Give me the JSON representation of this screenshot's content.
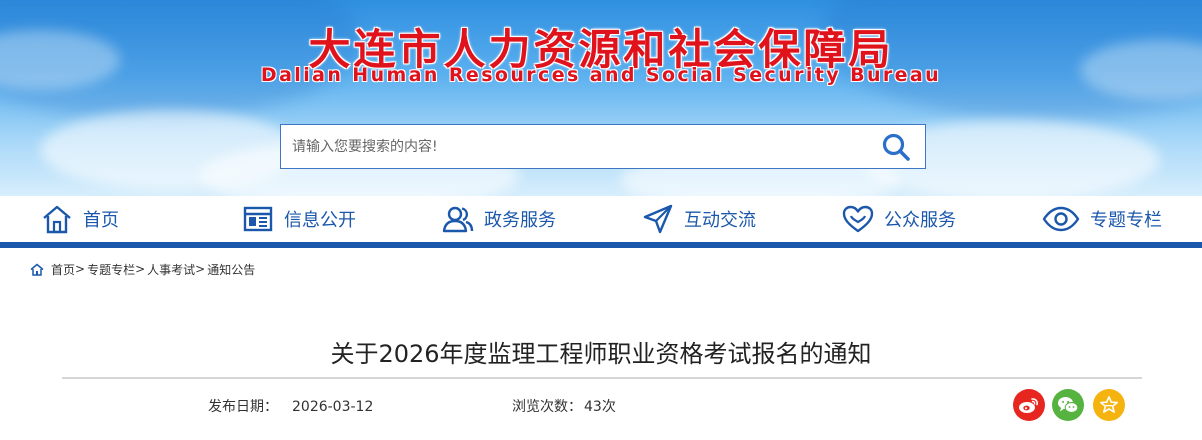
{
  "header": {
    "title": "大连市人力资源和社会保障局",
    "subtitle": "Dalian Human Resources and Social Security Bureau",
    "title_color": "#e0121b"
  },
  "search": {
    "placeholder": "请输入您要搜索的内容!",
    "value": "",
    "icon": "search-icon"
  },
  "nav": {
    "accent": "#1b58ab",
    "items": [
      {
        "label": "首页",
        "icon": "home-icon"
      },
      {
        "label": "信息公开",
        "icon": "info-panel-icon"
      },
      {
        "label": "政务服务",
        "icon": "users-icon"
      },
      {
        "label": "互动交流",
        "icon": "send-icon"
      },
      {
        "label": "公众服务",
        "icon": "heart-icon"
      },
      {
        "label": "专题专栏",
        "icon": "eye-icon"
      }
    ]
  },
  "breadcrumb": {
    "items": [
      "首页",
      "专题专栏",
      "人事考试",
      "通知公告"
    ],
    "separator": ">"
  },
  "article": {
    "title": "关于2026年度监理工程师职业资格考试报名的通知",
    "publish_label": "发布日期：",
    "publish_date": "2026-03-12",
    "views_label": "浏览次数：",
    "views": "43次"
  },
  "share": {
    "items": [
      {
        "icon": "weibo-icon",
        "color": "#e6261f"
      },
      {
        "icon": "wechat-icon",
        "color": "#56b340"
      },
      {
        "icon": "favorite-star-icon",
        "color": "#f5b30f"
      }
    ]
  }
}
